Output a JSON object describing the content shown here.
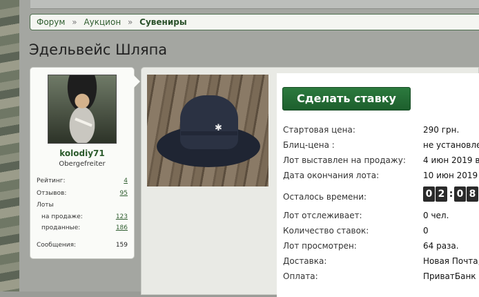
{
  "breadcrumb": {
    "items": [
      "Форум",
      "Аукцион"
    ],
    "separator": "»",
    "current": "Сувениры"
  },
  "page_title": "Эдельвейс Шляпа",
  "user": {
    "username": "kolodiy71",
    "title": "Obergefreiter",
    "stats": {
      "rating_label": "Рейтинг:",
      "rating_value": "4",
      "reviews_label": "Отзывов:",
      "reviews_value": "95",
      "lots_label": "Лоты",
      "on_sale_label": "на продаже:",
      "on_sale_value": "123",
      "sold_label": "проданные:",
      "sold_value": "186",
      "messages_label": "Сообщения:",
      "messages_value": "159"
    }
  },
  "lot": {
    "bid_button": "Сделать ставку",
    "start_price_label": "Стартовая цена:",
    "start_price_value": "290 грн.",
    "blitz_label": "Блиц-цена :",
    "blitz_value": "не установлен",
    "listed_label": "Лот выставлен на продажу:",
    "listed_value": "4 июн 2019 в",
    "end_label": "Дата окончания лота:",
    "end_value": "10 июн 2019 в",
    "remaining_label": "Осталось времени:",
    "timer_digits": [
      "0",
      "2",
      "0",
      "8"
    ],
    "timer_separator": ":",
    "watchers_label": "Лот отслеживает:",
    "watchers_value": "0 чел.",
    "bids_label": "Количество ставок:",
    "bids_value": "0",
    "views_label": "Лот просмотрен:",
    "views_value": "64 раза.",
    "delivery_label": "Доставка:",
    "delivery_value": "Новая Почта,",
    "payment_label": "Оплата:",
    "payment_value": "ПриватБанк"
  },
  "colors": {
    "accent_green": "#2c7a3e",
    "link_green": "#2f5d2f"
  }
}
